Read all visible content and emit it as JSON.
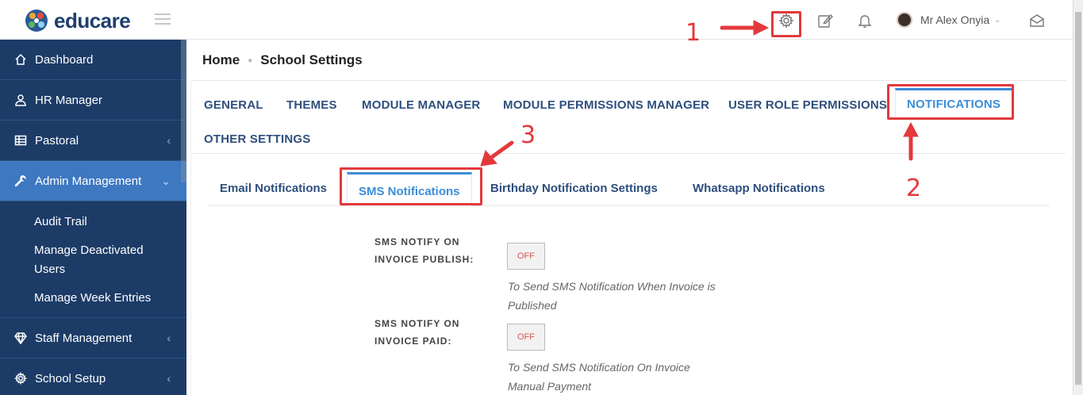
{
  "app": {
    "logo_text": "educare",
    "user_name": "Mr Alex Onyia"
  },
  "header_icons": [
    "gear-icon",
    "edit-icon",
    "bell-icon",
    "mail-icon"
  ],
  "sidebar": {
    "items": [
      {
        "label": "Dashboard",
        "icon": "home-icon"
      },
      {
        "label": "HR Manager",
        "icon": "user-icon"
      },
      {
        "label": "Pastoral",
        "icon": "table-icon",
        "arrow": "‹"
      },
      {
        "label": "Admin Management",
        "icon": "wrench-icon",
        "arrow": "⌄"
      }
    ],
    "sub_items": [
      "Audit Trail",
      "Manage Deactivated Users",
      "Manage Week Entries"
    ],
    "after_items": [
      {
        "label": "Staff Management",
        "icon": "diamond-icon",
        "arrow": "‹"
      },
      {
        "label": "School Setup",
        "icon": "gear-icon",
        "arrow": "‹"
      }
    ]
  },
  "breadcrumb": {
    "home": "Home",
    "current": "School Settings"
  },
  "tabs": [
    "GENERAL",
    "THEMES",
    "MODULE MANAGER",
    "MODULE PERMISSIONS MANAGER",
    "USER ROLE PERMISSIONS",
    "NOTIFICATIONS",
    "OTHER SETTINGS"
  ],
  "active_tab": "NOTIFICATIONS",
  "subtabs": [
    "Email Notifications",
    "SMS Notifications",
    "Birthday Notification Settings",
    "Whatsapp Notifications"
  ],
  "active_subtab": "SMS Notifications",
  "settings": [
    {
      "label_line1": "SMS NOTIFY ON",
      "label_line2": "INVOICE PUBLISH:",
      "toggle": "OFF",
      "hint_line1": "To Send SMS Notification When Invoice is",
      "hint_line2": "Published"
    },
    {
      "label_line1": "SMS NOTIFY ON",
      "label_line2": "INVOICE PAID:",
      "toggle": "OFF",
      "hint_line1": "To Send SMS Notification On Invoice",
      "hint_line2": "Manual Payment"
    }
  ],
  "annotations": {
    "step1": "1",
    "step2": "2",
    "step3": "3"
  },
  "colors": {
    "sidebar": "#1c3c67",
    "sidebar_active": "#3d78c1",
    "accent": "#3b8ed8",
    "annotation": "#e3393c"
  }
}
